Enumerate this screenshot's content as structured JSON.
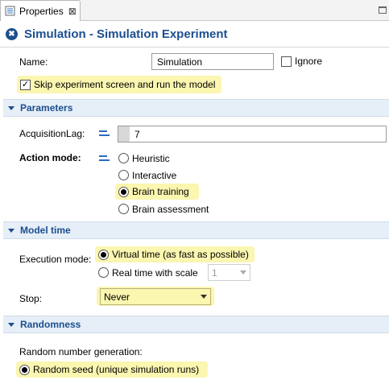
{
  "tab": {
    "label": "Properties",
    "close": "⊠"
  },
  "header": {
    "title": "Simulation - Simulation Experiment"
  },
  "general": {
    "name_label": "Name:",
    "name_value": "Simulation",
    "ignore_label": "Ignore",
    "ignore_checked": false,
    "skip_label": "Skip experiment screen and run the model",
    "skip_checked": true
  },
  "parameters": {
    "title": "Parameters",
    "acquisition_label": "AcquisitionLag:",
    "acquisition_value": "7",
    "action_label": "Action mode:",
    "action_options": [
      "Heuristic",
      "Interactive",
      "Brain training",
      "Brain assessment"
    ],
    "action_selected": "Brain training"
  },
  "model_time": {
    "title": "Model time",
    "execution_label": "Execution mode:",
    "virtual_label": "Virtual time (as fast as possible)",
    "real_label": "Real time with scale",
    "scale_value": "1",
    "stop_label": "Stop:",
    "stop_value": "Never"
  },
  "randomness": {
    "title": "Randomness",
    "rng_label": "Random number generation:",
    "seed_label": "Random seed (unique simulation runs)"
  },
  "colors": {
    "accent": "#1b4f8e",
    "highlight": "#fbf6b0",
    "section_bg": "#e6eef8"
  }
}
